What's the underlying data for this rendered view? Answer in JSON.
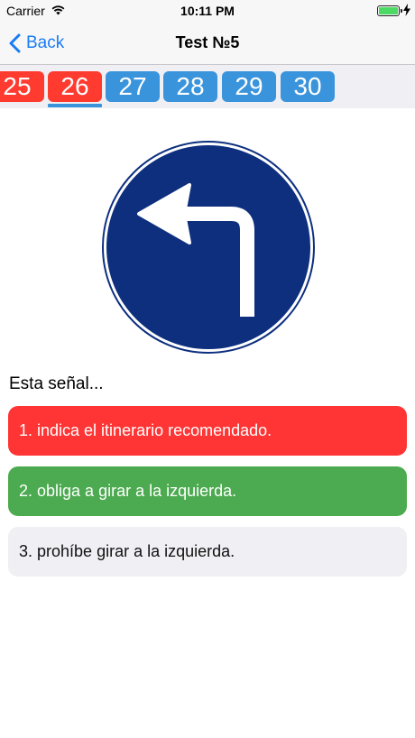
{
  "status_bar": {
    "carrier": "Carrier",
    "time": "10:11 PM",
    "battery_level": 1.0
  },
  "nav": {
    "back_label": "Back",
    "title": "Test №5"
  },
  "question_tabs": [
    {
      "label": "25",
      "state": "wrong"
    },
    {
      "label": "26",
      "state": "wrong",
      "selected": true
    },
    {
      "label": "27",
      "state": "open"
    },
    {
      "label": "28",
      "state": "open"
    },
    {
      "label": "29",
      "state": "open"
    },
    {
      "label": "30",
      "state": "open"
    }
  ],
  "sign": {
    "icon": "turn-left-arrow-icon",
    "color": "#0d2f7e"
  },
  "question": {
    "text": "Esta señal..."
  },
  "answers": [
    {
      "label": "1. indica el itinerario recomendado.",
      "state": "wrong",
      "color": "#ff3434"
    },
    {
      "label": "2. obliga a girar a la izquierda.",
      "state": "correct",
      "color": "#4caa50"
    },
    {
      "label": "3. prohíbe girar a la izquierda.",
      "state": "neutral",
      "color": "#efeff4"
    }
  ],
  "colors": {
    "tint": "#1a7cf5",
    "tab_open": "#3a94dc",
    "tab_wrong": "#ff3b30"
  }
}
